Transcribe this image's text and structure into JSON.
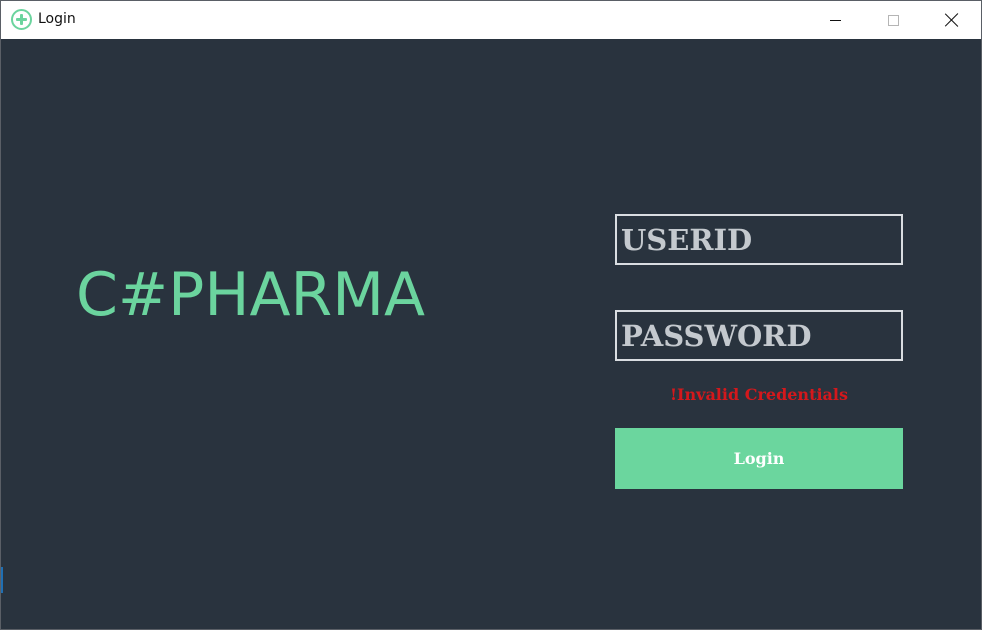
{
  "window": {
    "title": "Login",
    "icon": "plus-circle-icon",
    "controls": {
      "minimize": "minimize-icon",
      "maximize": "maximize-icon",
      "close": "close-icon"
    }
  },
  "brand": {
    "name": "C#PHARMA"
  },
  "form": {
    "userid": {
      "value": "",
      "placeholder": "USERID"
    },
    "password": {
      "value": "",
      "placeholder": "PASSWORD"
    },
    "error_message": "!Invalid Credentials",
    "login_label": "Login"
  },
  "colors": {
    "background": "#29333e",
    "accent": "#6bd49e",
    "error": "#d4181c",
    "field_border": "#d9dde1",
    "field_text": "#c4c9ce"
  }
}
